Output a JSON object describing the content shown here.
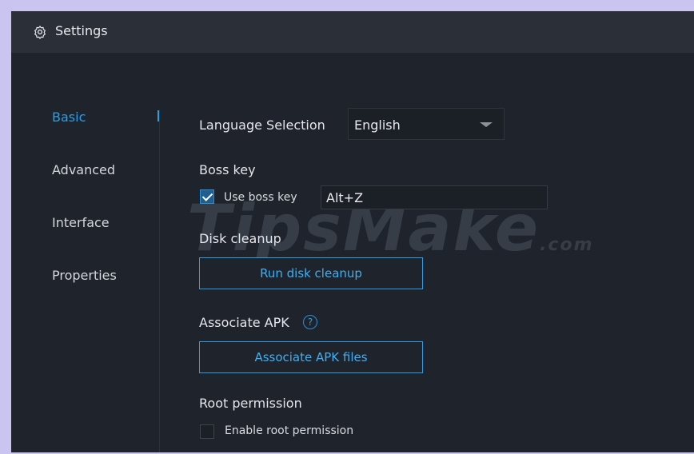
{
  "window": {
    "title": "Settings",
    "icon": "gear-icon"
  },
  "sidebar": {
    "items": [
      {
        "label": "Basic",
        "active": true
      },
      {
        "label": "Advanced",
        "active": false
      },
      {
        "label": "Interface",
        "active": false
      },
      {
        "label": "Properties",
        "active": false
      }
    ]
  },
  "basic": {
    "language": {
      "label": "Language Selection",
      "value": "English"
    },
    "boss_key": {
      "label": "Boss key",
      "checkbox_label": "Use boss key",
      "checked": true,
      "value": "Alt+Z"
    },
    "disk_cleanup": {
      "label": "Disk cleanup",
      "button": "Run disk cleanup"
    },
    "associate_apk": {
      "label": "Associate APK",
      "help": "?",
      "button": "Associate APK files"
    },
    "root_permission": {
      "label": "Root permission",
      "checkbox_label": "Enable root permission",
      "checked": false
    }
  },
  "watermark": {
    "text": "TipsMake",
    "suffix": ".com"
  },
  "colors": {
    "accent": "#2b9fe6",
    "window_bg": "#1f232b",
    "titlebar_bg": "#2a2f38",
    "frame": "#c9c4f0"
  }
}
